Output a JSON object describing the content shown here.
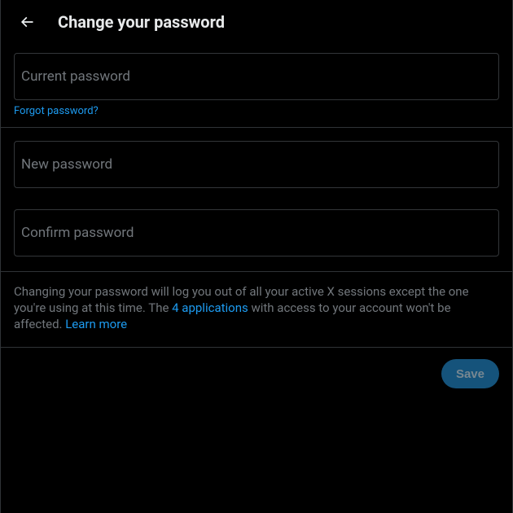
{
  "header": {
    "title": "Change your password"
  },
  "fields": {
    "current": {
      "label": "Current password"
    },
    "forgot": "Forgot password?",
    "new": {
      "label": "New password"
    },
    "confirm": {
      "label": "Confirm password"
    }
  },
  "info": {
    "part1": "Changing your password will log you out of all your active X sessions except the one you're using at this time. The ",
    "applications_link": "4 applications",
    "part2": " with access to your account won't be affected. ",
    "learn_more": "Learn more"
  },
  "actions": {
    "save": "Save"
  }
}
